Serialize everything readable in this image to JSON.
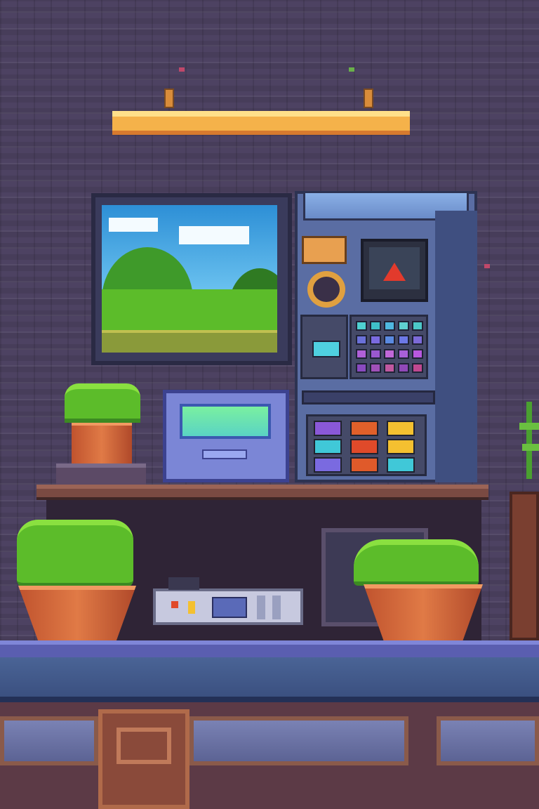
{
  "scene": {
    "colors": {
      "wall": "#4d4262",
      "lamp": "#f5b24a",
      "shelf": "#7a4a42",
      "machine": "#5a6da3",
      "console": "#7b86d6",
      "pot": "#e07a46",
      "foliage": "#5cbc2a",
      "counter": "#5a5eb0"
    },
    "icons": [
      "ceiling-lamp",
      "landscape-monitor",
      "control-machine",
      "radar-display",
      "handheld-console",
      "potted-plant",
      "control-device"
    ],
    "key_grid_colors": [
      "#4fd0d0",
      "#3fc0c8",
      "#4fb8e0",
      "#5fd0d0",
      "#4cc8c8",
      "#6a70d8",
      "#7a6ae0",
      "#5a8ae0",
      "#6c78e6",
      "#7c6ad8",
      "#b060d8",
      "#9a58d0",
      "#c068d8",
      "#a860d8",
      "#b858e0",
      "#8a4ac0",
      "#a050b8",
      "#c058a0",
      "#9048b8",
      "#c04890"
    ],
    "pad_colors": [
      "#8a58d8",
      "#e0602a",
      "#f4c030",
      "#40c8d8",
      "#e04a2a",
      "#f4c030",
      "#7a6ae0",
      "#e05a2a",
      "#40c8d8"
    ]
  }
}
